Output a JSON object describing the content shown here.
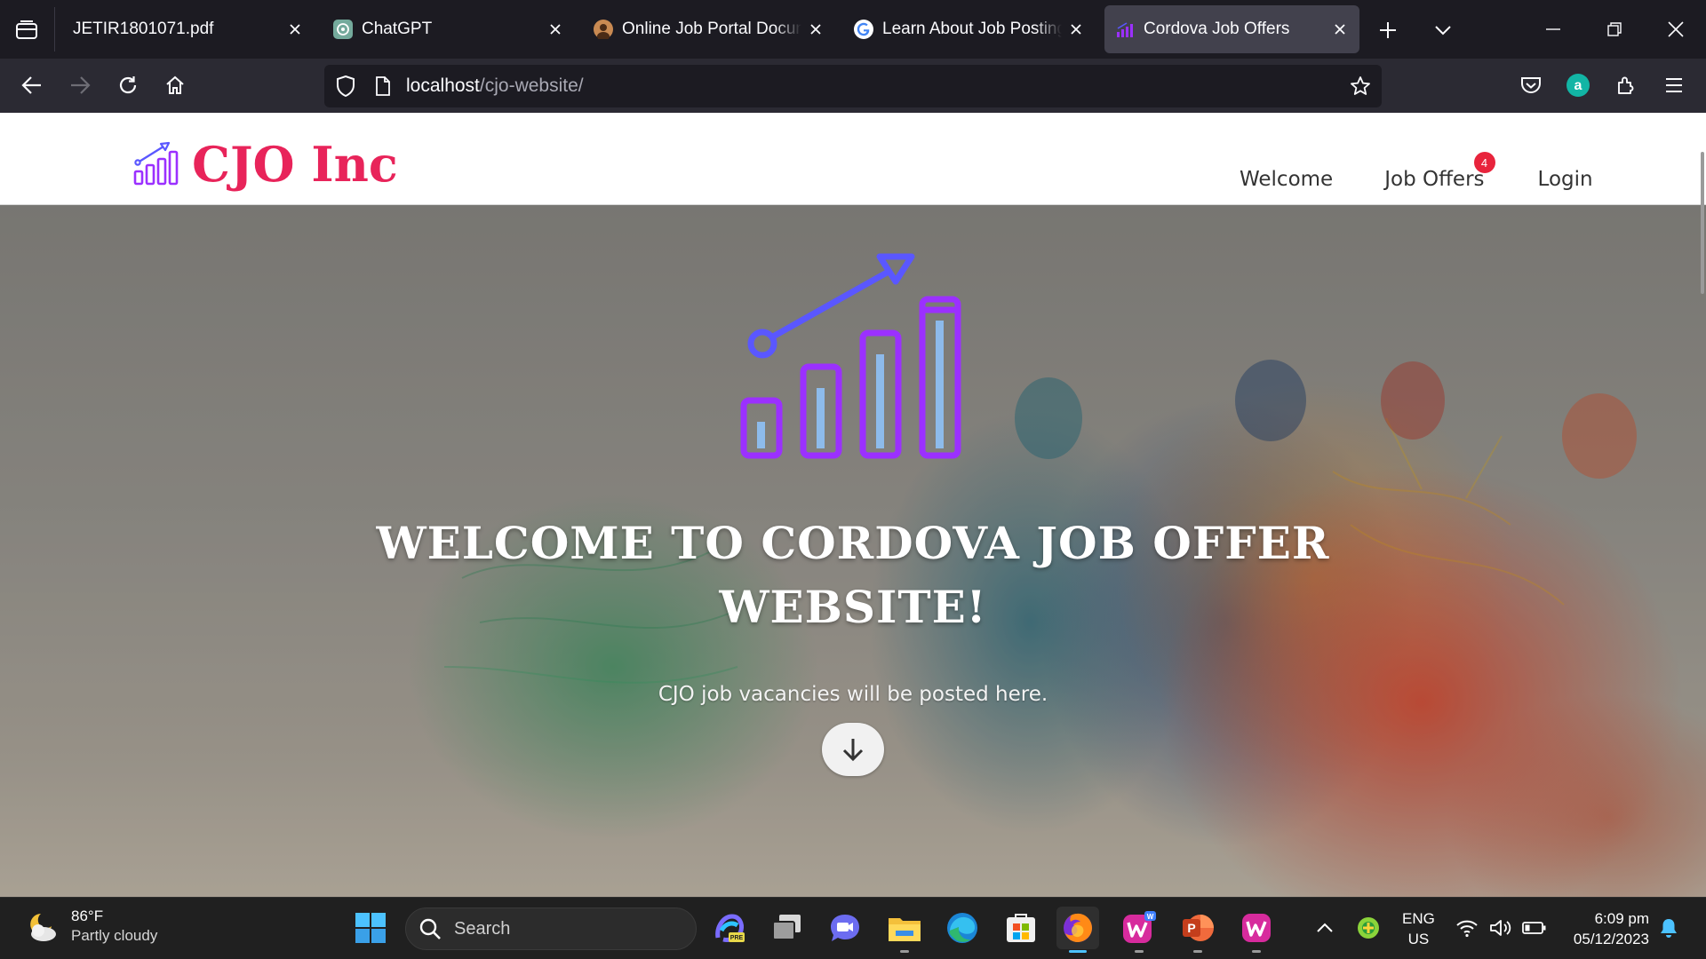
{
  "browser": {
    "tabs": [
      {
        "title": "JETIR1801071.pdf",
        "favicon": "pdf-icon",
        "active": false
      },
      {
        "title": "ChatGPT",
        "favicon": "chatgpt-icon",
        "active": false
      },
      {
        "title": "Online Job Portal Docume",
        "favicon": "avatar-icon",
        "active": false
      },
      {
        "title": "Learn About Job Posting S",
        "favicon": "google-icon",
        "active": false
      },
      {
        "title": "Cordova Job Offers",
        "favicon": "chart-icon",
        "active": true
      }
    ],
    "url": {
      "host": "localhost",
      "path": "/cjo-website/"
    }
  },
  "site": {
    "brand": "CJO Inc",
    "nav": [
      {
        "label": "Welcome"
      },
      {
        "label": "Job Offers",
        "badge": "4"
      },
      {
        "label": "Login"
      }
    ],
    "hero": {
      "title_line1": "WELCOME TO CORDOVA JOB OFFER",
      "title_line2": "WEBSITE!",
      "subtitle": "CJO job vacancies will be posted here."
    },
    "colors": {
      "brand": "#e8245a",
      "badge": "#e8243c",
      "logo_purple": "#9b30ff",
      "logo_blue": "#5a57ff"
    }
  },
  "taskbar": {
    "weather": {
      "temp": "86°F",
      "condition": "Partly cloudy"
    },
    "search_placeholder": "Search",
    "lang_line1": "ENG",
    "lang_line2": "US",
    "time": "6:09 pm",
    "date": "05/12/2023"
  }
}
